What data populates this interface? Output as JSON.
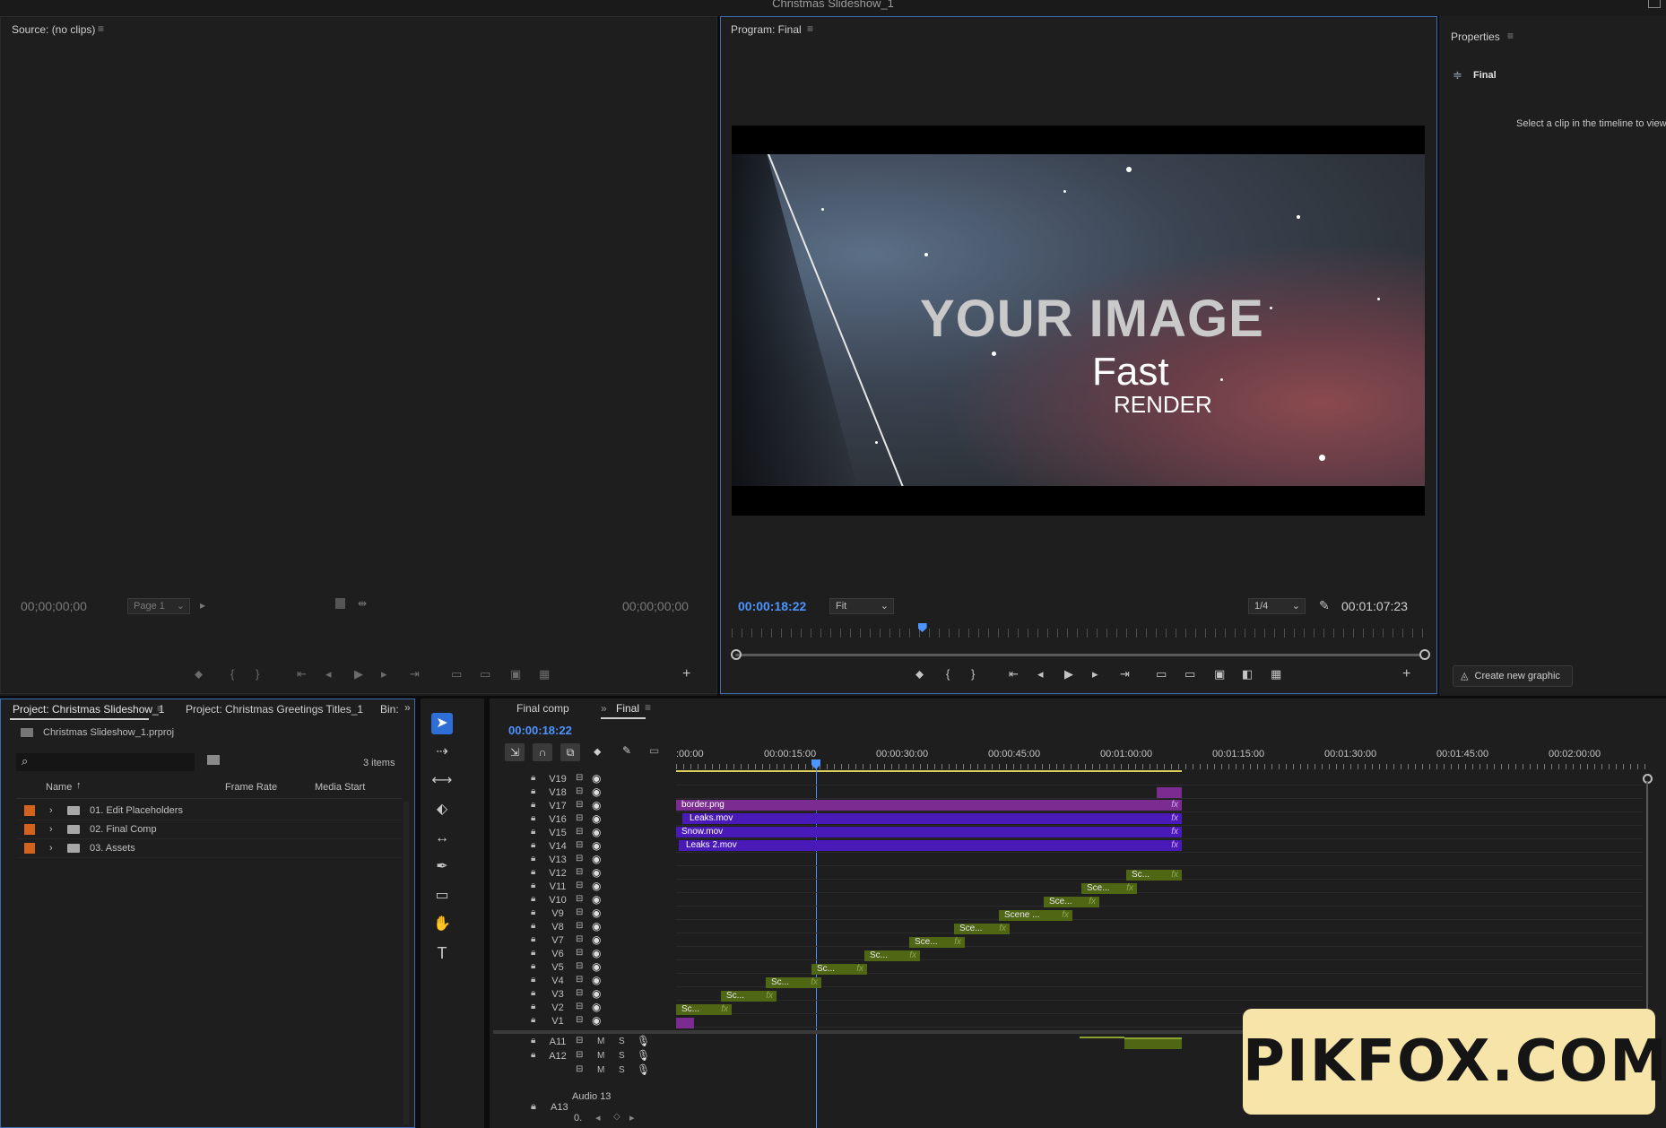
{
  "app": {
    "title": "Christmas Slideshow_1"
  },
  "source_monitor": {
    "tab": "Source: (no clips)",
    "timecode_in": "00;00;00;00",
    "page_select": "Page 1",
    "timecode_out": "00;00;00;00"
  },
  "program_monitor": {
    "tab": "Program: Final",
    "timecode": "00:00:18:22",
    "zoom": "Fit",
    "resolution": "1/4",
    "duration": "00:01:07:23",
    "playhead_fraction": 0.275,
    "video": {
      "headline": "YOUR IMAGE",
      "line2": "Fast",
      "line3": "RENDER"
    }
  },
  "properties": {
    "tab": "Properties",
    "item": "Final",
    "hint": "Select a clip in the timeline to view",
    "create_button": "Create new graphic"
  },
  "project": {
    "tabs": [
      "Project: Christmas Slideshow_1",
      "Project: Christmas Greetings Titles_1",
      "Bin:"
    ],
    "file": "Christmas Slideshow_1.prproj",
    "count": "3 items",
    "columns": [
      "Name",
      "Frame Rate",
      "Media Start"
    ],
    "items": [
      {
        "label": "01. Edit Placeholders",
        "color": "#d2621c"
      },
      {
        "label": "02. Final Comp",
        "color": "#d2621c"
      },
      {
        "label": "03. Assets",
        "color": "#d2621c"
      }
    ]
  },
  "tools": [
    "selection-tool-icon",
    "track-select-icon",
    "ripple-edit-icon",
    "razor-icon",
    "slip-icon",
    "pen-icon",
    "rectangle-icon",
    "hand-icon",
    "type-icon"
  ],
  "timeline": {
    "tabs": [
      "Final comp",
      "Final"
    ],
    "timecode": "00:00:18:22",
    "ruler": [
      ":00:00",
      "00:00:15:00",
      "00:00:30:00",
      "00:00:45:00",
      "00:01:00:00",
      "00:01:15:00",
      "00:01:30:00",
      "00:01:45:00",
      "00:02:00:00"
    ],
    "video_tracks": [
      "V19",
      "V18",
      "V17",
      "V16",
      "V15",
      "V14",
      "V13",
      "V12",
      "V11",
      "V10",
      "V9",
      "V8",
      "V7",
      "V6",
      "V5",
      "V4",
      "V3",
      "V2",
      "V1"
    ],
    "audio_tracks": [
      "A11",
      "A12",
      ""
    ],
    "audio_labels": {
      "mute": "M",
      "solo": "S"
    },
    "audio13": {
      "name": "Audio 13",
      "label": "A13",
      "value": "0."
    },
    "clips": {
      "border": "border.png",
      "leaks": "Leaks.mov",
      "snow": "Snow.mov",
      "leaks2": "Leaks 2.mov",
      "sc": "Sc...",
      "sce": "Sce...",
      "scene": "Scene ...",
      "fx": "fx"
    }
  },
  "watermark": "PIKFOX.COM"
}
